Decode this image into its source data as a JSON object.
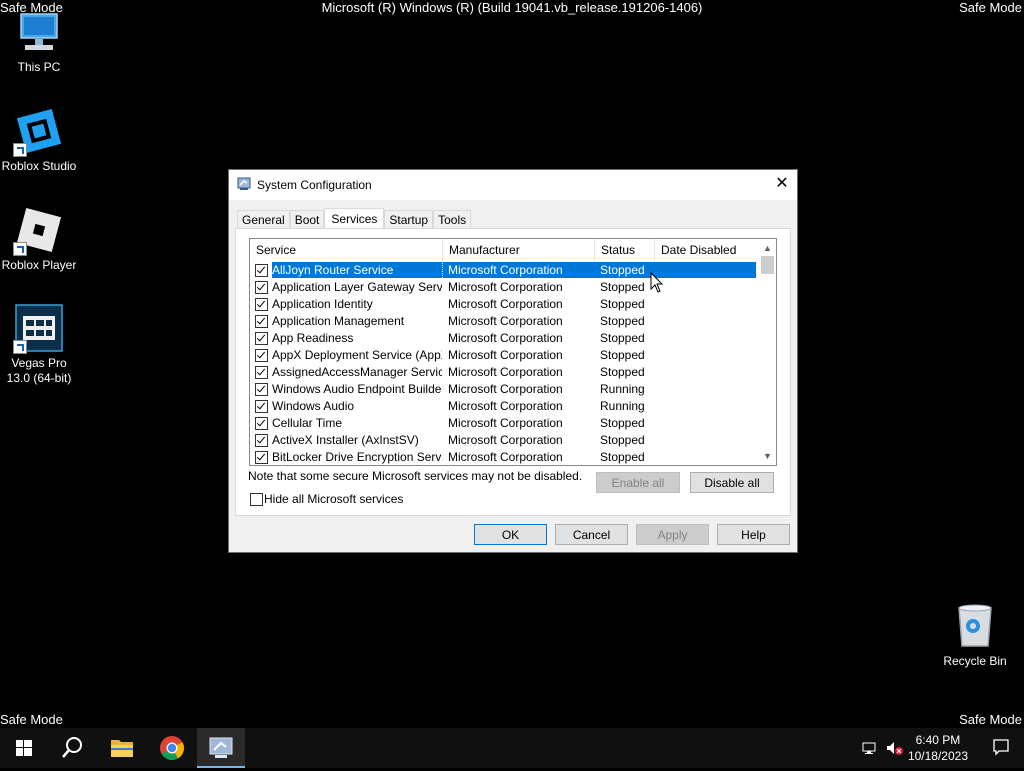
{
  "overlay": {
    "safe_mode": "Safe Mode",
    "build": "Microsoft (R) Windows (R) (Build 19041.vb_release.191206-1406)"
  },
  "desktop": {
    "icons": [
      {
        "label": "This PC",
        "icon": "computer-icon"
      },
      {
        "label": "Roblox Studio",
        "icon": "roblox-studio-icon"
      },
      {
        "label": "Roblox Player",
        "icon": "roblox-player-icon"
      },
      {
        "label": "Vegas Pro 13.0 (64-bit)",
        "icon": "vegas-pro-icon"
      },
      {
        "label": "Recycle Bin",
        "icon": "recycle-bin-icon"
      }
    ]
  },
  "dialog": {
    "title": "System Configuration",
    "tabs": [
      "General",
      "Boot",
      "Services",
      "Startup",
      "Tools"
    ],
    "active_tab": "Services",
    "columns": [
      "Service",
      "Manufacturer",
      "Status",
      "Date Disabled"
    ],
    "rows": [
      {
        "service": "AllJoyn Router Service",
        "manufacturer": "Microsoft Corporation",
        "status": "Stopped",
        "date_disabled": "",
        "checked": true,
        "selected": true
      },
      {
        "service": "Application Layer Gateway Service",
        "manufacturer": "Microsoft Corporation",
        "status": "Stopped",
        "date_disabled": "",
        "checked": true
      },
      {
        "service": "Application Identity",
        "manufacturer": "Microsoft Corporation",
        "status": "Stopped",
        "date_disabled": "",
        "checked": true
      },
      {
        "service": "Application Management",
        "manufacturer": "Microsoft Corporation",
        "status": "Stopped",
        "date_disabled": "",
        "checked": true
      },
      {
        "service": "App Readiness",
        "manufacturer": "Microsoft Corporation",
        "status": "Stopped",
        "date_disabled": "",
        "checked": true
      },
      {
        "service": "AppX Deployment Service (AppX...",
        "manufacturer": "Microsoft Corporation",
        "status": "Stopped",
        "date_disabled": "",
        "checked": true
      },
      {
        "service": "AssignedAccessManager Service",
        "manufacturer": "Microsoft Corporation",
        "status": "Stopped",
        "date_disabled": "",
        "checked": true
      },
      {
        "service": "Windows Audio Endpoint Builder",
        "manufacturer": "Microsoft Corporation",
        "status": "Running",
        "date_disabled": "",
        "checked": true
      },
      {
        "service": "Windows Audio",
        "manufacturer": "Microsoft Corporation",
        "status": "Running",
        "date_disabled": "",
        "checked": true
      },
      {
        "service": "Cellular Time",
        "manufacturer": "Microsoft Corporation",
        "status": "Stopped",
        "date_disabled": "",
        "checked": true
      },
      {
        "service": "ActiveX Installer (AxInstSV)",
        "manufacturer": "Microsoft Corporation",
        "status": "Stopped",
        "date_disabled": "",
        "checked": true
      },
      {
        "service": "BitLocker Drive Encryption Service",
        "manufacturer": "Microsoft Corporation",
        "status": "Stopped",
        "date_disabled": "",
        "checked": true
      }
    ],
    "note": "Note that some secure Microsoft services may not be disabled.",
    "enable_all": "Enable all",
    "disable_all": "Disable all",
    "hide_ms": "Hide all Microsoft services",
    "ok": "OK",
    "cancel": "Cancel",
    "apply": "Apply",
    "help": "Help",
    "close_glyph": "✕"
  },
  "taskbar": {
    "pinned": [
      "start-icon",
      "search-icon",
      "file-explorer-icon",
      "chrome-icon",
      "system-configuration-icon"
    ],
    "time": "6:40 PM",
    "date": "10/18/2023"
  }
}
